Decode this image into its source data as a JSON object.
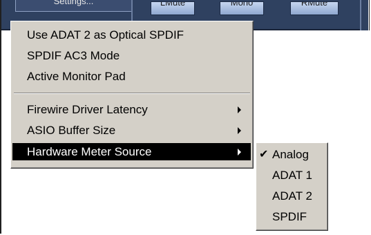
{
  "toolbar": {
    "settings_label": "Settings...",
    "lmute_label": "LMute",
    "mono_label": "Mono",
    "rmute_label": "RMute"
  },
  "menu": {
    "items": [
      {
        "label": "Use ADAT 2 as Optical SPDIF"
      },
      {
        "label": "SPDIF AC3 Mode"
      },
      {
        "label": "Active Monitor Pad"
      },
      {
        "label": "Firewire Driver Latency",
        "has_submenu": true
      },
      {
        "label": "ASIO Buffer Size",
        "has_submenu": true
      },
      {
        "label": "Hardware Meter Source",
        "has_submenu": true,
        "selected": true
      }
    ]
  },
  "submenu": {
    "items": [
      {
        "label": "Analog",
        "checked": true,
        "check_glyph": "✔"
      },
      {
        "label": "ADAT 1"
      },
      {
        "label": "ADAT 2"
      },
      {
        "label": "SPDIF"
      }
    ]
  },
  "colors": {
    "toolbar_bg": "#2f4160",
    "menu_bg": "#d4d0c8",
    "selected_bg": "#000000",
    "selected_fg": "#ffffff"
  }
}
